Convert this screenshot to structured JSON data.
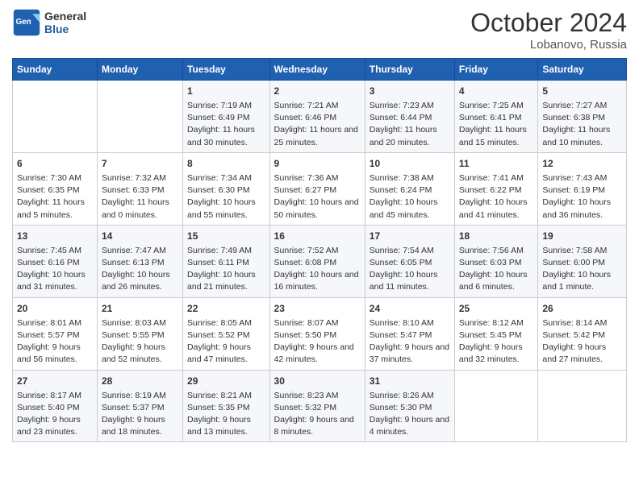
{
  "header": {
    "logo_general": "General",
    "logo_blue": "Blue",
    "month_title": "October 2024",
    "location": "Lobanovo, Russia"
  },
  "columns": [
    "Sunday",
    "Monday",
    "Tuesday",
    "Wednesday",
    "Thursday",
    "Friday",
    "Saturday"
  ],
  "weeks": [
    [
      {
        "num": "",
        "info": ""
      },
      {
        "num": "",
        "info": ""
      },
      {
        "num": "1",
        "info": "Sunrise: 7:19 AM\nSunset: 6:49 PM\nDaylight: 11 hours and 30 minutes."
      },
      {
        "num": "2",
        "info": "Sunrise: 7:21 AM\nSunset: 6:46 PM\nDaylight: 11 hours and 25 minutes."
      },
      {
        "num": "3",
        "info": "Sunrise: 7:23 AM\nSunset: 6:44 PM\nDaylight: 11 hours and 20 minutes."
      },
      {
        "num": "4",
        "info": "Sunrise: 7:25 AM\nSunset: 6:41 PM\nDaylight: 11 hours and 15 minutes."
      },
      {
        "num": "5",
        "info": "Sunrise: 7:27 AM\nSunset: 6:38 PM\nDaylight: 11 hours and 10 minutes."
      }
    ],
    [
      {
        "num": "6",
        "info": "Sunrise: 7:30 AM\nSunset: 6:35 PM\nDaylight: 11 hours and 5 minutes."
      },
      {
        "num": "7",
        "info": "Sunrise: 7:32 AM\nSunset: 6:33 PM\nDaylight: 11 hours and 0 minutes."
      },
      {
        "num": "8",
        "info": "Sunrise: 7:34 AM\nSunset: 6:30 PM\nDaylight: 10 hours and 55 minutes."
      },
      {
        "num": "9",
        "info": "Sunrise: 7:36 AM\nSunset: 6:27 PM\nDaylight: 10 hours and 50 minutes."
      },
      {
        "num": "10",
        "info": "Sunrise: 7:38 AM\nSunset: 6:24 PM\nDaylight: 10 hours and 45 minutes."
      },
      {
        "num": "11",
        "info": "Sunrise: 7:41 AM\nSunset: 6:22 PM\nDaylight: 10 hours and 41 minutes."
      },
      {
        "num": "12",
        "info": "Sunrise: 7:43 AM\nSunset: 6:19 PM\nDaylight: 10 hours and 36 minutes."
      }
    ],
    [
      {
        "num": "13",
        "info": "Sunrise: 7:45 AM\nSunset: 6:16 PM\nDaylight: 10 hours and 31 minutes."
      },
      {
        "num": "14",
        "info": "Sunrise: 7:47 AM\nSunset: 6:13 PM\nDaylight: 10 hours and 26 minutes."
      },
      {
        "num": "15",
        "info": "Sunrise: 7:49 AM\nSunset: 6:11 PM\nDaylight: 10 hours and 21 minutes."
      },
      {
        "num": "16",
        "info": "Sunrise: 7:52 AM\nSunset: 6:08 PM\nDaylight: 10 hours and 16 minutes."
      },
      {
        "num": "17",
        "info": "Sunrise: 7:54 AM\nSunset: 6:05 PM\nDaylight: 10 hours and 11 minutes."
      },
      {
        "num": "18",
        "info": "Sunrise: 7:56 AM\nSunset: 6:03 PM\nDaylight: 10 hours and 6 minutes."
      },
      {
        "num": "19",
        "info": "Sunrise: 7:58 AM\nSunset: 6:00 PM\nDaylight: 10 hours and 1 minute."
      }
    ],
    [
      {
        "num": "20",
        "info": "Sunrise: 8:01 AM\nSunset: 5:57 PM\nDaylight: 9 hours and 56 minutes."
      },
      {
        "num": "21",
        "info": "Sunrise: 8:03 AM\nSunset: 5:55 PM\nDaylight: 9 hours and 52 minutes."
      },
      {
        "num": "22",
        "info": "Sunrise: 8:05 AM\nSunset: 5:52 PM\nDaylight: 9 hours and 47 minutes."
      },
      {
        "num": "23",
        "info": "Sunrise: 8:07 AM\nSunset: 5:50 PM\nDaylight: 9 hours and 42 minutes."
      },
      {
        "num": "24",
        "info": "Sunrise: 8:10 AM\nSunset: 5:47 PM\nDaylight: 9 hours and 37 minutes."
      },
      {
        "num": "25",
        "info": "Sunrise: 8:12 AM\nSunset: 5:45 PM\nDaylight: 9 hours and 32 minutes."
      },
      {
        "num": "26",
        "info": "Sunrise: 8:14 AM\nSunset: 5:42 PM\nDaylight: 9 hours and 27 minutes."
      }
    ],
    [
      {
        "num": "27",
        "info": "Sunrise: 8:17 AM\nSunset: 5:40 PM\nDaylight: 9 hours and 23 minutes."
      },
      {
        "num": "28",
        "info": "Sunrise: 8:19 AM\nSunset: 5:37 PM\nDaylight: 9 hours and 18 minutes."
      },
      {
        "num": "29",
        "info": "Sunrise: 8:21 AM\nSunset: 5:35 PM\nDaylight: 9 hours and 13 minutes."
      },
      {
        "num": "30",
        "info": "Sunrise: 8:23 AM\nSunset: 5:32 PM\nDaylight: 9 hours and 8 minutes."
      },
      {
        "num": "31",
        "info": "Sunrise: 8:26 AM\nSunset: 5:30 PM\nDaylight: 9 hours and 4 minutes."
      },
      {
        "num": "",
        "info": ""
      },
      {
        "num": "",
        "info": ""
      }
    ]
  ]
}
